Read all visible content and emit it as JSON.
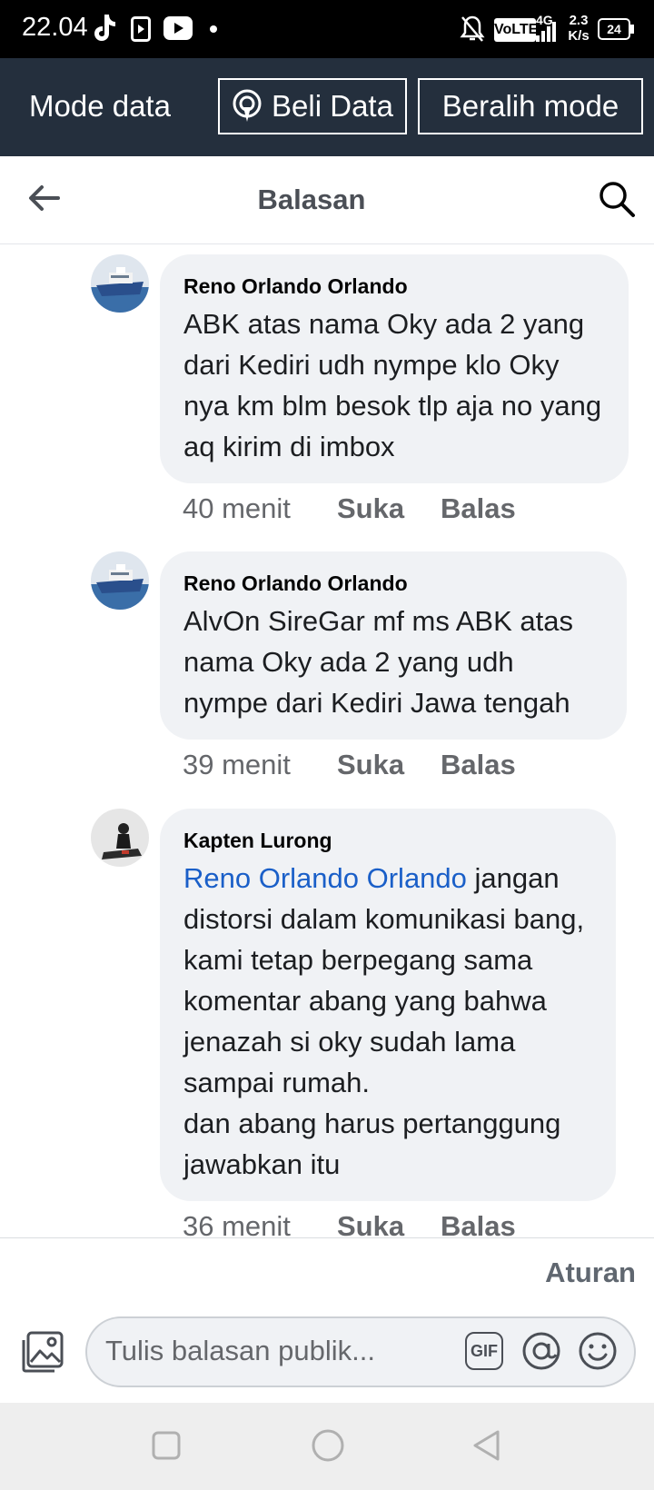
{
  "status_bar": {
    "time": "22.04",
    "volte": "VoLTE",
    "network": "4G",
    "speed_top": "2.3",
    "speed_bottom": "K/s",
    "battery": "24"
  },
  "data_mode_bar": {
    "label": "Mode data",
    "buy_button": "Beli Data",
    "switch_button": "Beralih mode"
  },
  "header": {
    "title": "Balasan"
  },
  "comments": [
    {
      "author": "Reno Orlando Orlando",
      "text": "ABK atas nama Oky ada 2 yang dari Kediri udh nympe klo Oky nya km blm besok tlp aja no yang aq kirim di imbox",
      "time": "40 menit",
      "like": "Suka",
      "reply": "Balas"
    },
    {
      "author": "Reno Orlando Orlando",
      "text": "AlvOn SireGar mf ms ABK atas nama Oky ada 2 yang udh nympe dari Kediri Jawa tengah",
      "time": "39 menit",
      "like": "Suka",
      "reply": "Balas"
    },
    {
      "author": "Kapten Lurong",
      "mention": "Reno Orlando Orlando",
      "text_after_mention": " jangan distorsi dalam komunikasi bang, kami tetap berpegang sama komentar abang yang bahwa jenazah si oky sudah lama sampai rumah.",
      "text_line2": "dan abang harus pertanggung jawabkan itu",
      "time": "36 menit",
      "like": "Suka",
      "reply": "Balas"
    }
  ],
  "composer": {
    "rules": "Aturan",
    "placeholder": "Tulis balasan publik...",
    "gif": "GIF"
  },
  "icons": {
    "back": "arrow-left-icon",
    "search": "search-icon",
    "photo": "photo-icon",
    "mention": "at-icon",
    "emoji": "emoji-icon"
  }
}
